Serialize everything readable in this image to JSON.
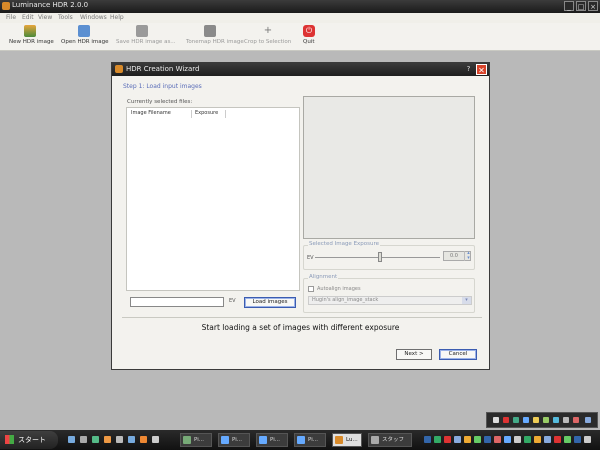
{
  "window": {
    "title": "Luminance HDR 2.0.0"
  },
  "menu": [
    "File",
    "Edit",
    "View",
    "Tools",
    "Windows",
    "Help"
  ],
  "toolbar": {
    "new_hdr": "New HDR image",
    "open_hdr": "Open HDR image",
    "save_hdr": "Save HDR image as...",
    "tonemap": "Tonemap HDR image",
    "crop": "Crop to Selection",
    "quit": "Quit"
  },
  "dialog": {
    "title": "HDR Creation Wizard",
    "step_link": "Step 1: Load input images",
    "selected_files_label": "Currently selected files:",
    "columns": [
      "Image Filename",
      "Exposure"
    ],
    "path_value": "",
    "ev_label": "EV",
    "load_button": "Load images",
    "exposure_group": "Selected Image Exposure",
    "ev_short": "EV",
    "ev_value": "0.0",
    "alignment_group": "Alignment",
    "autoalign_label": "Autoalign images",
    "align_method": "Hugin's align_image_stack",
    "status": "Start loading a set of images with different exposure",
    "next_button": "Next >",
    "cancel_button": "Cancel"
  },
  "taskbar": {
    "start": "スタート",
    "tasks": [
      "Pi...",
      "Pi...",
      "Pi...",
      "Lu...",
      "スタッフ"
    ]
  },
  "colors": {
    "accent": "#3b5cb0",
    "link": "#5a6db8",
    "close": "#d9432a"
  }
}
